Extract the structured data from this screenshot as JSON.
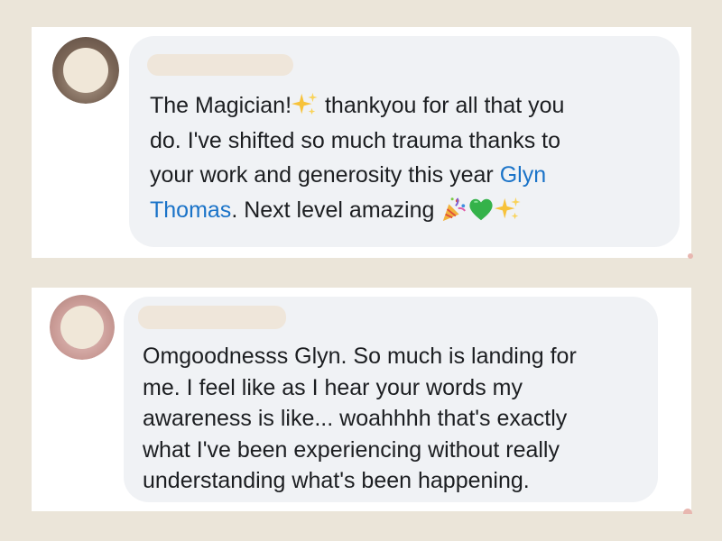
{
  "comments": [
    {
      "name_redacted": true,
      "text_lines": [
        {
          "before": "The Magician!",
          "after": " thankyou for all that you"
        },
        {
          "text": "do. I've shifted so much trauma thanks to"
        },
        {
          "before": "your work and generosity this year ",
          "mention": "Glyn"
        },
        {
          "mention": "Thomas",
          "after": ". Next level amazing "
        }
      ],
      "emojis": [
        "sparkles-emoji",
        "party-popper-emoji",
        "green-heart-emoji",
        "sparkles-emoji"
      ]
    },
    {
      "name_redacted": true,
      "text_lines": [
        "Omgoodnesss Glyn. So much is landing for",
        "me. I feel like as I hear your words my",
        "awareness is like... woahhhh that's exactly",
        "what I've been experiencing without really",
        "understanding what's been happening."
      ]
    }
  ],
  "colors": {
    "page_background": "#ebe5d9",
    "card_background": "#ffffff",
    "bubble_background": "#f0f2f5",
    "text": "#1c1e21",
    "mention": "#1a73c8",
    "redaction_pill": "#efe6da"
  }
}
